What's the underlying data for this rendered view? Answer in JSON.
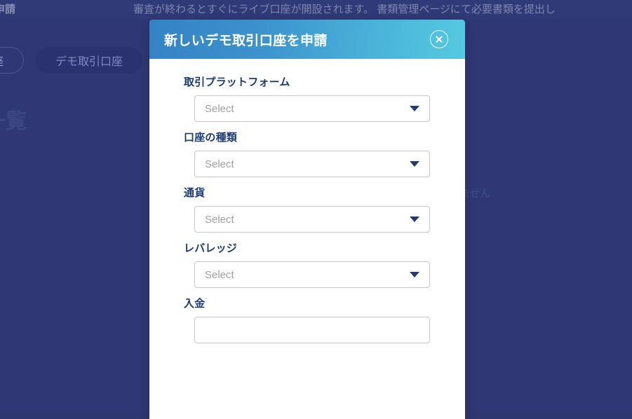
{
  "background": {
    "overlay_color": "#2f3874",
    "banner": {
      "left_text_truncated": "申請",
      "message_truncated": "審査が終わるとすぐにライブ口座が開設されます。 書類管理ページにて必要書類を提出し"
    },
    "tabs": [
      {
        "label_truncated": "引口座",
        "state": "inactive"
      },
      {
        "label": "デモ取引口座",
        "state": "active"
      }
    ],
    "heading_truncated": "座一覧",
    "note_truncated": "ません"
  },
  "modal": {
    "title": "新しいデモ取引口座を申請",
    "close_icon": "close-circle-icon",
    "header_gradient_start": "#3482c4",
    "header_gradient_end": "#56cae2",
    "label_color": "#1f3c72",
    "fields": [
      {
        "label": "取引プラットフォーム",
        "type": "select",
        "placeholder": "Select",
        "value": "",
        "caret_icon": "chevron-down-icon"
      },
      {
        "label": "口座の種類",
        "type": "select",
        "placeholder": "Select",
        "value": "",
        "caret_icon": "chevron-down-icon"
      },
      {
        "label": "通貨",
        "type": "select",
        "placeholder": "Select",
        "value": "",
        "caret_icon": "chevron-down-icon"
      },
      {
        "label": "レバレッジ",
        "type": "select",
        "placeholder": "Select",
        "value": "",
        "caret_icon": "chevron-down-icon"
      },
      {
        "label": "入金",
        "type": "text",
        "placeholder": "",
        "value": ""
      }
    ]
  }
}
